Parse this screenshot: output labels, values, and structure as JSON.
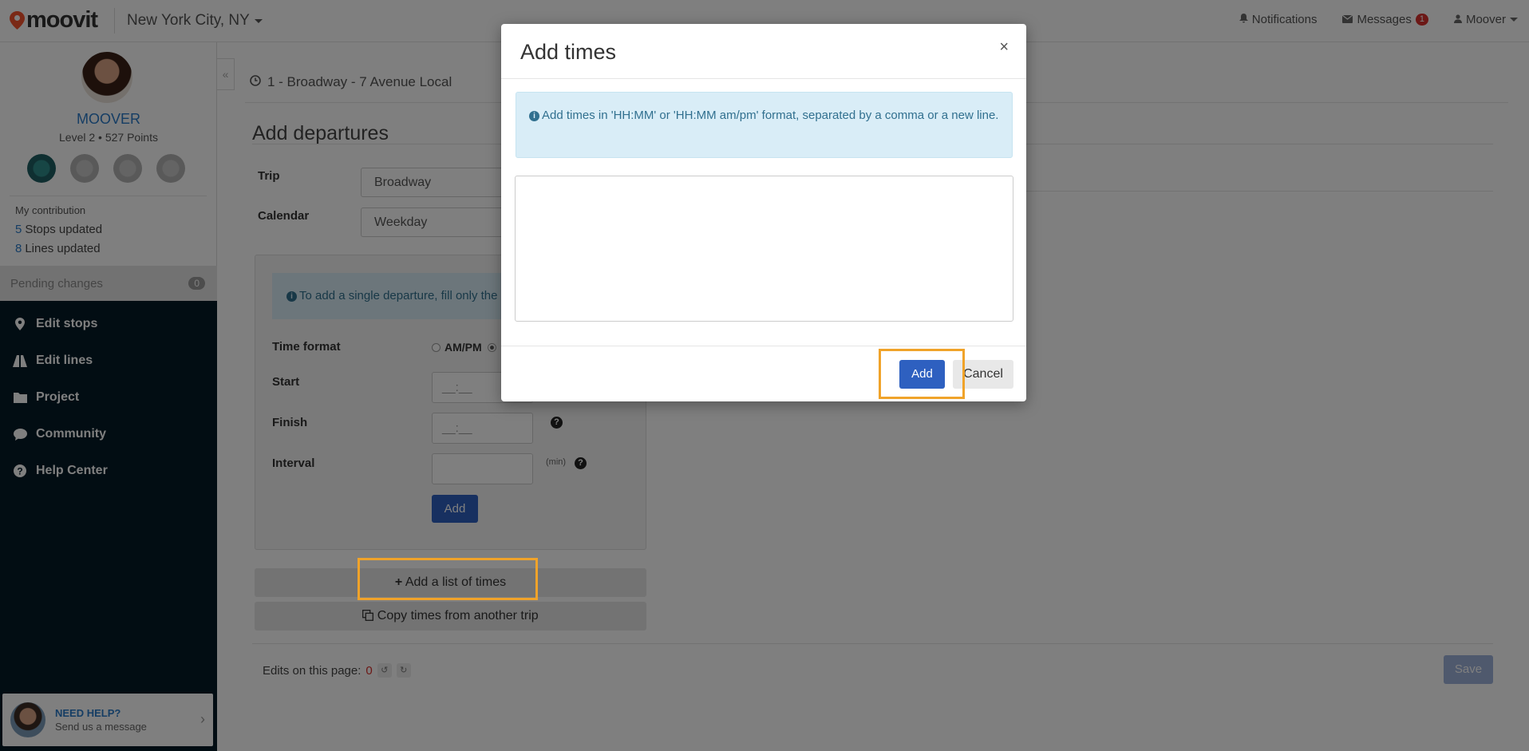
{
  "header": {
    "logo_text": "moovit",
    "city": "New York City, NY",
    "notifications_label": "Notifications",
    "messages_label": "Messages",
    "messages_count": "1",
    "user_label": "Moover"
  },
  "sidebar": {
    "username": "MOOVER",
    "level_text": "Level 2 • 527 Points",
    "contribution_title": "My contribution",
    "stops_count": "5",
    "stops_label": "Stops updated",
    "lines_count": "8",
    "lines_label": "Lines updated",
    "pending_label": "Pending changes",
    "pending_count": "0",
    "menu": [
      {
        "label": "Edit stops",
        "icon": "map-pin-icon"
      },
      {
        "label": "Edit lines",
        "icon": "road-icon"
      },
      {
        "label": "Project",
        "icon": "folder-icon"
      },
      {
        "label": "Community",
        "icon": "chat-bubble-icon"
      },
      {
        "label": "Help Center",
        "icon": "question-circle-icon"
      }
    ],
    "help_title": "NEED HELP?",
    "help_subtitle": "Send us a message"
  },
  "main": {
    "breadcrumb": "1 - Broadway - 7 Avenue Local",
    "page_title": "Add departures",
    "trip_label": "Trip",
    "trip_value": "Broadway",
    "calendar_label": "Calendar",
    "calendar_value": "Weekday",
    "info_text": "To add a single departure, fill only the",
    "time_format_label": "Time format",
    "time_format_ampm": "AM/PM",
    "start_label": "Start",
    "finish_label": "Finish",
    "interval_label": "Interval",
    "time_placeholder": "__:__",
    "interval_unit": "(min)",
    "add_button": "Add",
    "add_list_button": "Add a list of times",
    "copy_times_button": "Copy times from another trip",
    "edits_label": "Edits on this page:",
    "edits_count": "0",
    "save_button": "Save"
  },
  "modal": {
    "title": "Add times",
    "close_symbol": "×",
    "info_text": "Add times in 'HH:MM' or 'HH:MM am/pm' format, separated by a comma or a new line.",
    "textarea_value": "",
    "add_button": "Add",
    "cancel_button": "Cancel"
  },
  "colors": {
    "accent": "#2e60c0",
    "sidebar_bg": "#041a26",
    "highlight": "#f0a32a",
    "info_bg": "#d9edf7"
  }
}
